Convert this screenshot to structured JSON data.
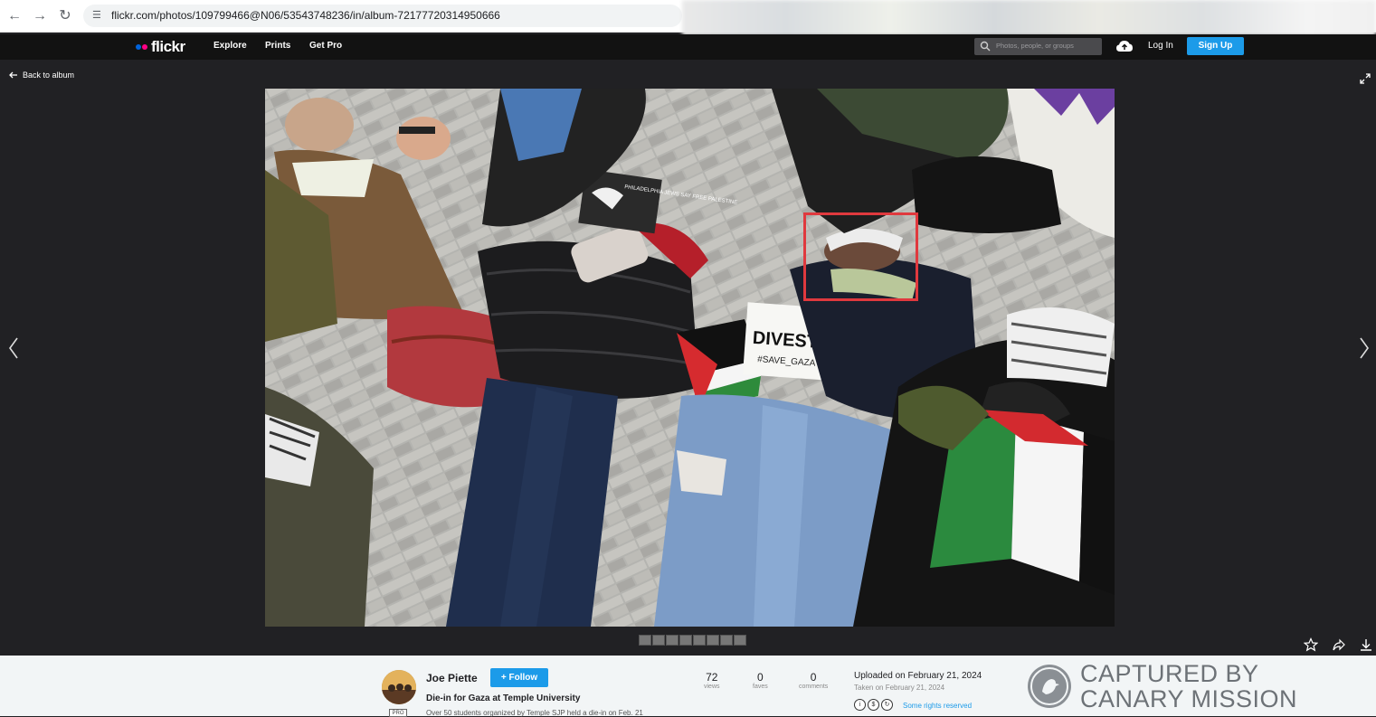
{
  "browser": {
    "url": "flickr.com/photos/109799466@N06/53543748236/in/album-72177720314950666"
  },
  "header": {
    "logo_text": "flickr",
    "nav": [
      "Explore",
      "Prints",
      "Get Pro"
    ],
    "search_placeholder": "Photos, people, or groups",
    "login_label": "Log In",
    "signup_label": "Sign Up"
  },
  "photo": {
    "back_label": "Back to album",
    "sign_text_1": "DIVEST NOW !!",
    "sign_text_2": "#SAVE_GAZA",
    "card_text": "PHILADELPHIA JEWS SAY FREE PALESTINE",
    "thumb_count": 8
  },
  "info": {
    "author": "Joe Piette",
    "follow_label": "+ Follow",
    "pro_badge": "PRO",
    "title": "Die-in for Gaza at Temple University",
    "description": "Over 50 students organized by Temple SJP held a die-in on Feb. 21",
    "stats": [
      {
        "value": "72",
        "label": "views"
      },
      {
        "value": "0",
        "label": "faves"
      },
      {
        "value": "0",
        "label": "comments"
      }
    ],
    "uploaded": "Uploaded on February 21, 2024",
    "taken": "Taken on February 21, 2024",
    "rights": "Some rights reserved"
  },
  "watermark": {
    "line1": "CAPTURED BY",
    "line2": "CANARY MISSION"
  },
  "colors": {
    "accent": "#1c9be9",
    "highlight": "#e0393e",
    "flickr_pink": "#ff0084",
    "flickr_blue": "#0063dc"
  }
}
